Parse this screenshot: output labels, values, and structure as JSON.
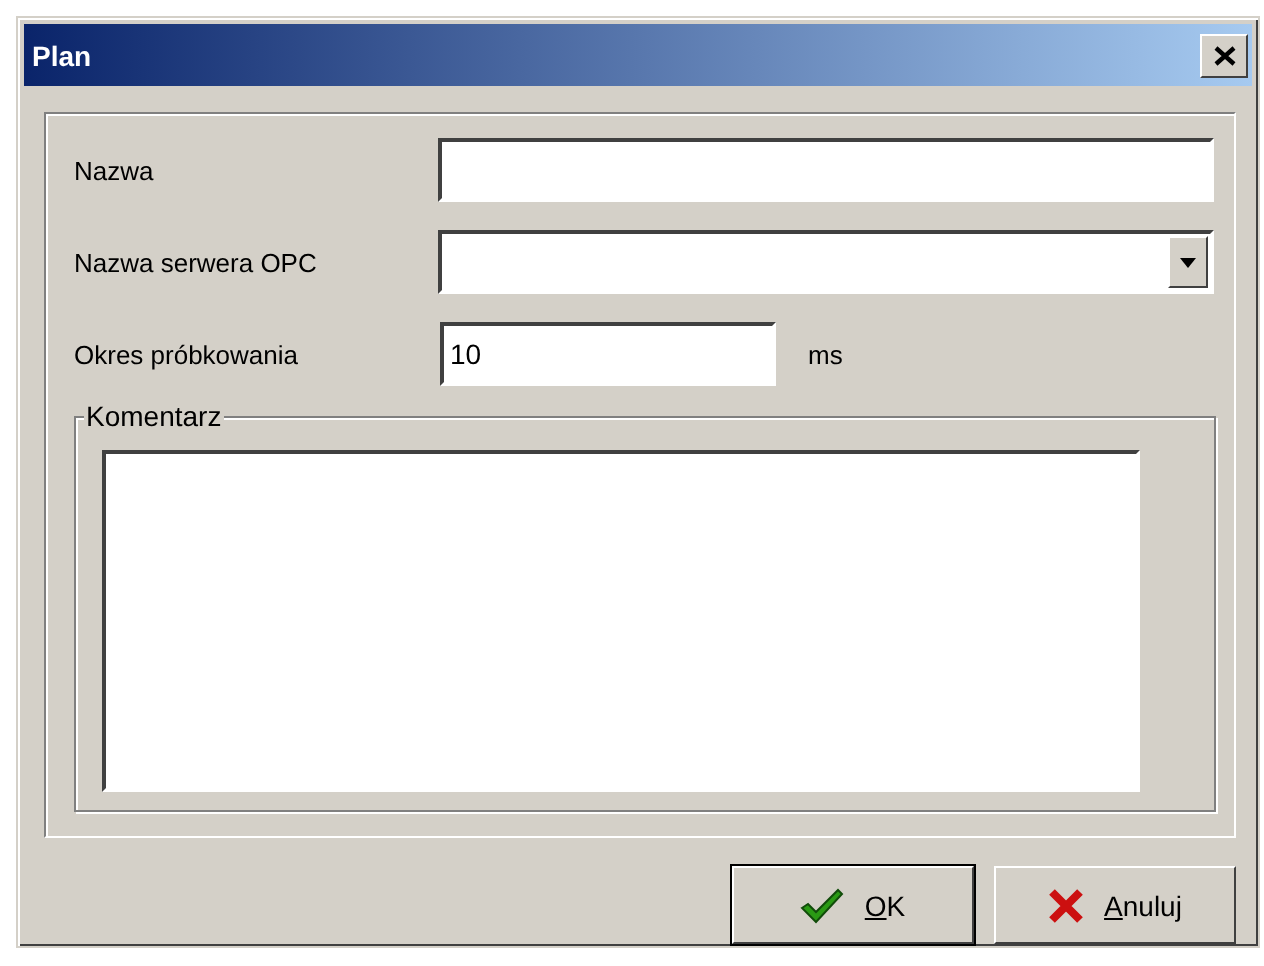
{
  "window": {
    "title": "Plan"
  },
  "fields": [
    {
      "kind": "text",
      "label": "Nazwa"
    },
    {
      "kind": "combo",
      "label": "Nazwa serwera OPC"
    },
    {
      "kind": "short",
      "label": "Okres próbkowania",
      "value": "10",
      "unit": "ms"
    }
  ],
  "comment": {
    "label": "Komentarz"
  },
  "buttons": [
    {
      "kind": "ok",
      "label": "OK",
      "default": true
    },
    {
      "kind": "cancel",
      "label": "Anuluj",
      "default": false
    }
  ]
}
